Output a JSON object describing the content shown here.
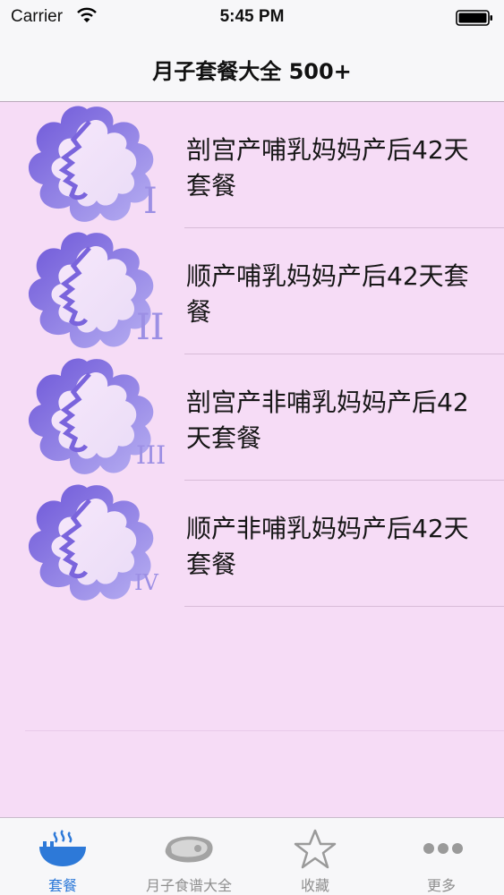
{
  "status_bar": {
    "carrier": "Carrier",
    "time": "5:45 PM"
  },
  "nav": {
    "title": "月子套餐大全 500+"
  },
  "rows": [
    {
      "label": "剖宫产哺乳妈妈产后42天套餐",
      "numeral": "I"
    },
    {
      "label": "顺产哺乳妈妈产后42天套餐",
      "numeral": "II"
    },
    {
      "label": "剖宫产非哺乳妈妈产后42天套餐",
      "numeral": "III"
    },
    {
      "label": "顺产非哺乳妈妈产后42天套餐",
      "numeral": "IV"
    }
  ],
  "tabs": [
    {
      "label": "套餐",
      "icon": "bowl-icon",
      "active": true
    },
    {
      "label": "月子食谱大全",
      "icon": "meat-icon",
      "active": false
    },
    {
      "label": "收藏",
      "icon": "star-icon",
      "active": false
    },
    {
      "label": "更多",
      "icon": "more-icon",
      "active": false
    }
  ],
  "colors": {
    "accent": "#2d79d8",
    "list_bg": "#f6dcf6",
    "flower": "#8c74de"
  }
}
